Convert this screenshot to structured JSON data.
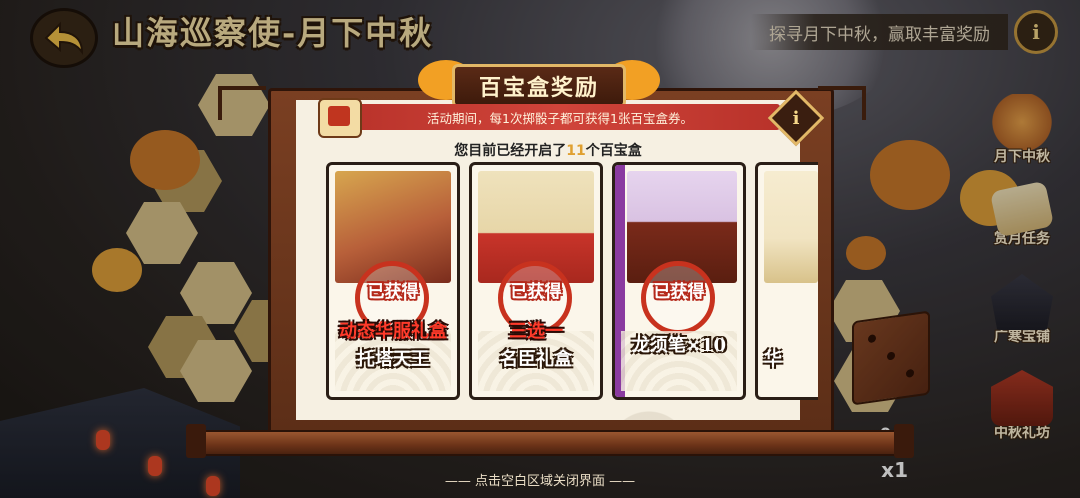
{
  "header": {
    "title": "山海巡察使-月下中秋",
    "banner": "探寻月下中秋，赢取丰富奖励",
    "info_label": "i"
  },
  "side_menu": [
    {
      "label": "月下中秋"
    },
    {
      "label": "赏月任务"
    },
    {
      "label": "广寒宝铺"
    },
    {
      "label": "中秋礼坊"
    }
  ],
  "board": {
    "counter": "0/1",
    "multiplier": "x1"
  },
  "modal": {
    "title": "百宝盒奖励",
    "notice": "活动期间，每1次掷骰子都可获得1张百宝盒券。",
    "opened_prefix": "您目前已经开启了",
    "opened_count": "11",
    "opened_suffix": "个百宝盒",
    "info_label": "i",
    "cards": [
      {
        "status": "已获得",
        "line1": "动态华服礼盒",
        "line2": "托塔天王",
        "art_color": "#b8603a"
      },
      {
        "status": "已获得",
        "line1": "三选一",
        "line2": "名臣礼盒",
        "art_color": "#e7d6a8"
      },
      {
        "status": "已获得",
        "line1": "龙须笔×10",
        "line2": "",
        "art_color": "#d9c2e2"
      },
      {
        "status": "",
        "line1": "",
        "line2": "华",
        "art_color": "#f1e4c2"
      }
    ]
  },
  "footer_hint": "—— 点击空白区域关闭界面 ——",
  "colors": {
    "accent_gold": "#e2b867",
    "stamp_red": "#c8321e",
    "notice_red": "#c43a30",
    "wood": "#6c3318"
  }
}
